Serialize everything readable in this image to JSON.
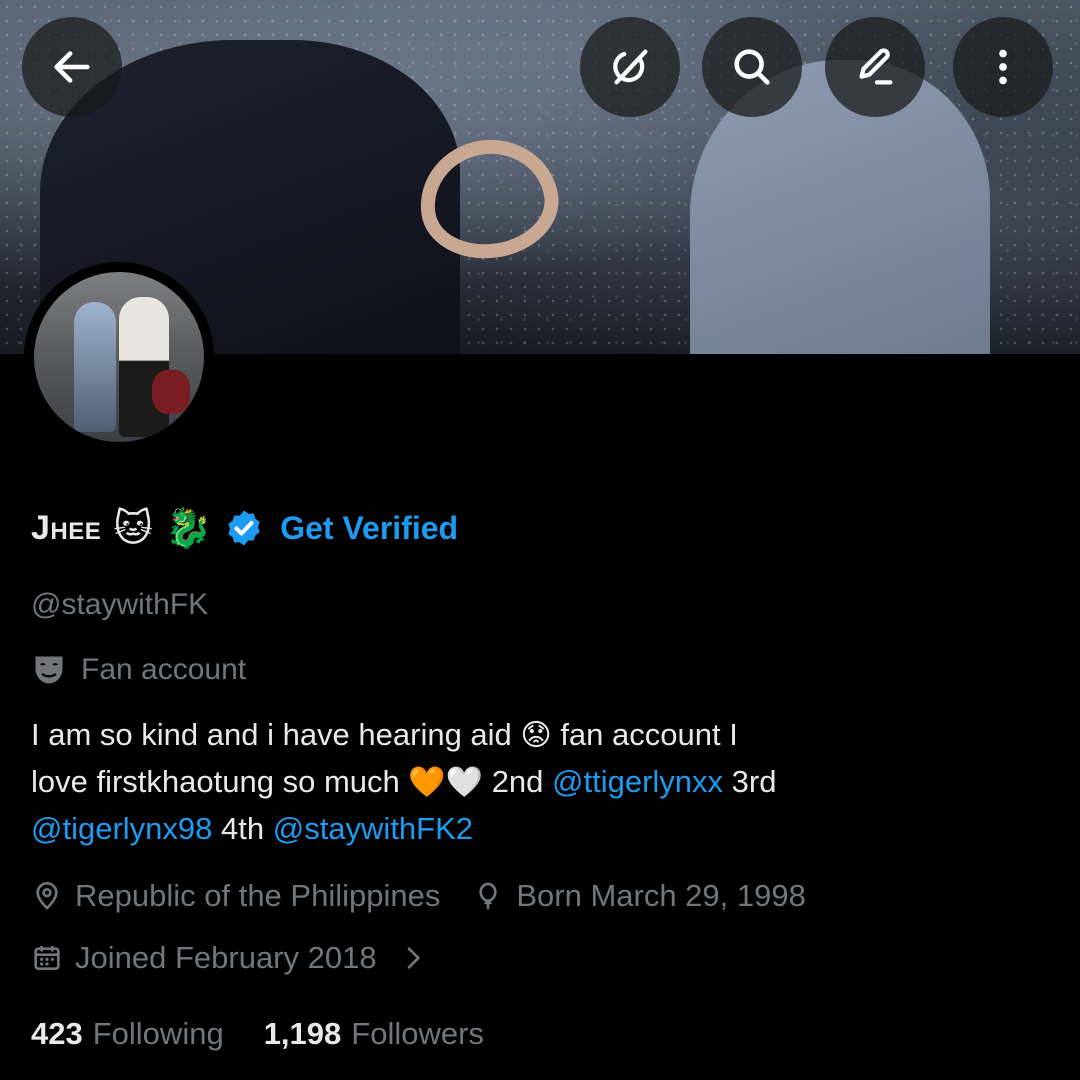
{
  "header": {
    "back_icon": "arrow-left-icon",
    "actions": [
      {
        "name": "grok-icon"
      },
      {
        "name": "search-icon"
      },
      {
        "name": "edit-icon"
      },
      {
        "name": "more-vertical-icon"
      }
    ]
  },
  "profile": {
    "display_name": "Jhee",
    "name_emojis": [
      "🐱",
      "🐉"
    ],
    "verified_badge_color": "#1d9bf0",
    "get_verified_label": "Get Verified",
    "handle": "@staywithFK",
    "category": "Fan account",
    "bio": {
      "line1_text": "I am so kind and i have hearing aid ",
      "line1_emoji": "😟",
      "line1_tail": " fan account I",
      "line2_text": "love firstkhaotung so much ",
      "line2_emojis": "🧡🤍",
      "line2_mid": " 2nd ",
      "mention_1": "@ttigerlynxx",
      "line2_tail": "  3rd",
      "mention_2": "@tigerlynx98",
      "line3_mid": " 4th ",
      "mention_3": "@staywithFK2"
    },
    "location": "Republic of the Philippines",
    "birthday": "Born March 29, 1998",
    "joined": "Joined February 2018",
    "following_count": "423",
    "following_label": "Following",
    "followers_count": "1,198",
    "followers_label": "Followers"
  },
  "colors": {
    "background": "#000000",
    "text_primary": "#e7e9ea",
    "text_secondary": "#71767b",
    "link": "#1d9bf0"
  }
}
